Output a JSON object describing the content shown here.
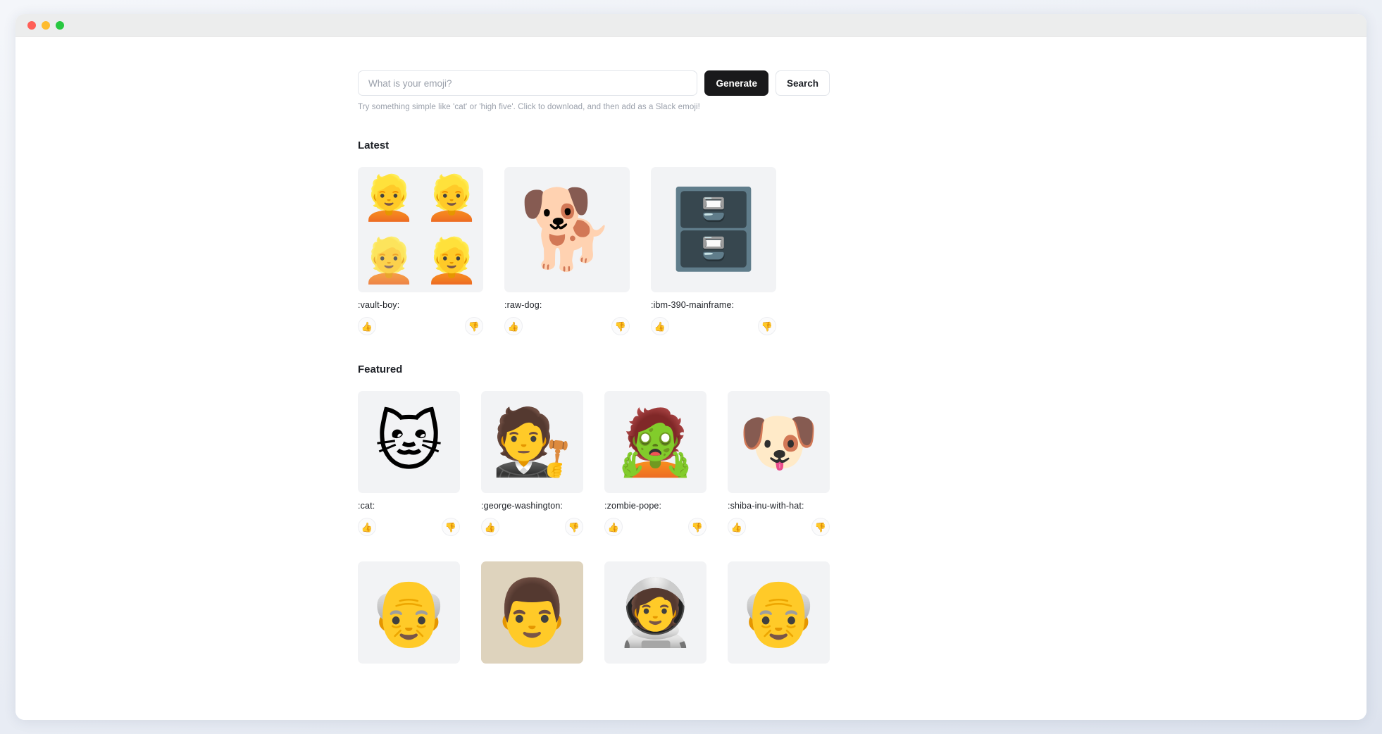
{
  "window": {
    "traffic_lights": [
      {
        "name": "close",
        "color": "#ff5f57"
      },
      {
        "name": "minimize",
        "color": "#febc2e"
      },
      {
        "name": "maximize",
        "color": "#28c840"
      }
    ]
  },
  "search": {
    "placeholder": "What is your emoji?",
    "value": "",
    "generate_label": "Generate",
    "search_label": "Search",
    "hint": "Try something simple like 'cat' or 'high five'. Click to download, and then add as a Slack emoji!"
  },
  "vote": {
    "up_icon": "👍",
    "down_icon": "👎"
  },
  "sections": [
    {
      "id": "latest",
      "title": "Latest",
      "columns": 3,
      "cards": [
        {
          "label": ":vault-boy:",
          "art": "composite-vault-boy",
          "art_glyphs": [
            "👱",
            "👱",
            "👱",
            "👱"
          ]
        },
        {
          "label": ":raw-dog:",
          "art": "🐕"
        },
        {
          "label": ":ibm-390-mainframe:",
          "art": "🗄️"
        }
      ]
    },
    {
      "id": "featured",
      "title": "Featured",
      "columns": 4,
      "cards": [
        {
          "label": ":cat:",
          "art": "🐱"
        },
        {
          "label": ":george-washington:",
          "art": "🧑‍⚖️"
        },
        {
          "label": ":zombie-pope:",
          "art": "🧟"
        },
        {
          "label": ":shiba-inu-with-hat:",
          "art": "🐶"
        },
        {
          "label": "",
          "art": "👴",
          "labelless": true
        },
        {
          "label": "",
          "art": "👨",
          "labelless": true,
          "tan": true
        },
        {
          "label": "",
          "art": "🧑‍🚀",
          "labelless": true
        },
        {
          "label": "",
          "art": "👴",
          "labelless": true
        }
      ]
    }
  ]
}
